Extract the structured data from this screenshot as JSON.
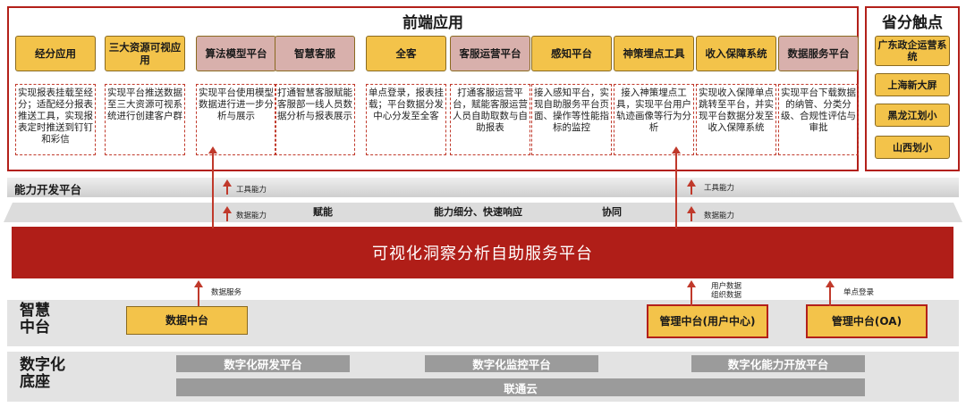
{
  "frontend": {
    "title": "前端应用",
    "apps": [
      {
        "label": "经分应用",
        "desc": "实现报表挂载至经分；适配经分报表推送工具，实现报表定时推送到钉钉和彩信"
      },
      {
        "label": "三大资源可视应用",
        "desc": "实现平台推送数据至三大资源可视系统进行创建客户群"
      },
      {
        "label": "算法模型平台",
        "desc": "实现平台使用模型数据进行进一步分析与展示"
      },
      {
        "label": "智慧客服",
        "desc": "打通智慧客服赋能客服部一线人员数据分析与报表展示"
      },
      {
        "label": "全客",
        "desc": "单点登录，报表挂载；平台数据分发中心分发至全客"
      },
      {
        "label": "客服运营平台",
        "desc": "打通客服运营平台，赋能客服运营人员自助取数与自助报表"
      },
      {
        "label": "感知平台",
        "desc": "接入感知平台，实现自助服务平台页面、操作等性能指标的监控"
      },
      {
        "label": "神策埋点工具",
        "desc": "接入神策埋点工具，实现平台用户轨迹画像等行为分析"
      },
      {
        "label": "收入保障系统",
        "desc": "实现收入保障单点跳转至平台，并实现平台数据分发至收入保障系统"
      },
      {
        "label": "数据服务平台",
        "desc": "实现平台下载数据的纳管、分类分级、合规性评估与审批"
      }
    ]
  },
  "province": {
    "title": "省分触点",
    "items": [
      "广东政企运营系统",
      "上海新大屏",
      "黑龙江划小",
      "山西划小"
    ]
  },
  "capability": {
    "title": "能力开发平台",
    "tool_label": "工具能力",
    "data_label": "数据能力",
    "band_items": [
      "赋能",
      "能力细分、快速响应",
      "协同"
    ]
  },
  "platform": {
    "title": "可视化洞察分析自助服务平台"
  },
  "middle": {
    "title": "智慧中台",
    "data_service_label": "数据服务",
    "user_org_label": "用户数据组织数据",
    "sso_label": "单点登录",
    "boxes": [
      "数据中台",
      "管理中台(用户中心)",
      "管理中台(OA)"
    ]
  },
  "base": {
    "title": "数字化底座",
    "bars": [
      "数字化研发平台",
      "数字化监控平台",
      "数字化能力开放平台"
    ],
    "cloud": "联通云"
  },
  "colors": {
    "accent_red": "#b01e18",
    "box_yellow": "#f3c34a",
    "box_pink": "#d8b0ac",
    "base_gray": "#9b9b9b"
  }
}
